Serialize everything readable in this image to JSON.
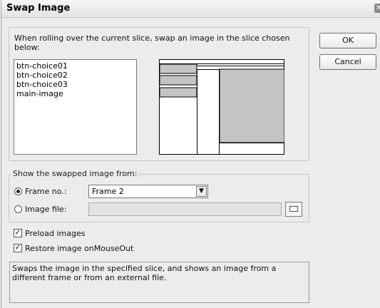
{
  "dialog": {
    "title": "Swap Image",
    "intro": "When rolling over the current slice, swap an image in the slice chosen below:",
    "slices": [
      "btn-choice01",
      "btn-choice02",
      "btn-choice03",
      "main-image"
    ]
  },
  "buttons": {
    "ok": "OK",
    "cancel": "Cancel"
  },
  "source": {
    "legend": "Show the swapped image from:",
    "frame_label": "Frame no.:",
    "frame_value": "Frame 2",
    "frame_selected": true,
    "image_label": "Image file:",
    "image_value": ""
  },
  "options": {
    "preload": "Preload images",
    "preload_checked": true,
    "restore": "Restore image onMouseOut",
    "restore_checked": true
  },
  "description": "Swaps the image in the specified slice, and shows an image from a different frame or from an external file."
}
